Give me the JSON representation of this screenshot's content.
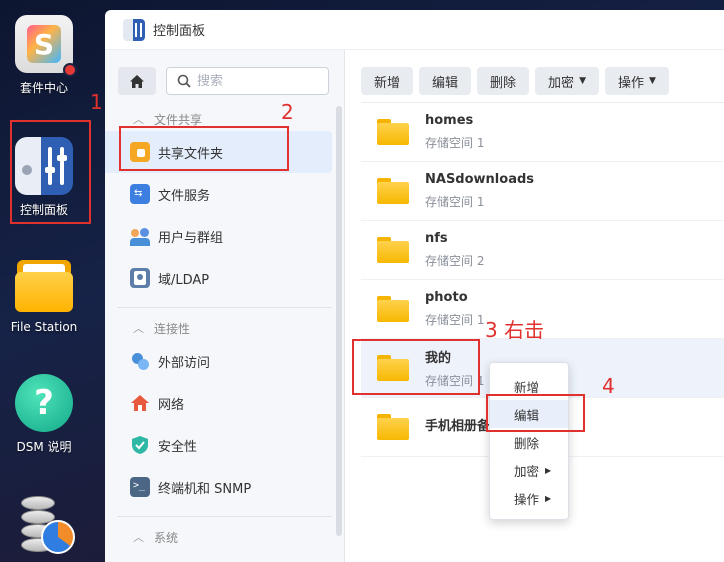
{
  "desktop": {
    "icons": [
      {
        "label": "套件中心"
      },
      {
        "label": "控制面板"
      },
      {
        "label": "File Station"
      },
      {
        "label": "DSM 说明"
      }
    ],
    "help_glyph": "?"
  },
  "window": {
    "title": "控制面板"
  },
  "sidebar": {
    "search_placeholder": "搜索",
    "sections": [
      {
        "title": "文件共享",
        "items": [
          {
            "label": "共享文件夹",
            "icon": "shared-folder-icon",
            "active": true
          },
          {
            "label": "文件服务",
            "icon": "file-services-icon"
          },
          {
            "label": "用户与群组",
            "icon": "users-groups-icon"
          },
          {
            "label": "域/LDAP",
            "icon": "domain-ldap-icon"
          }
        ]
      },
      {
        "title": "连接性",
        "items": [
          {
            "label": "外部访问",
            "icon": "external-access-icon"
          },
          {
            "label": "网络",
            "icon": "network-icon"
          },
          {
            "label": "安全性",
            "icon": "security-icon"
          },
          {
            "label": "终端机和 SNMP",
            "icon": "terminal-snmp-icon"
          }
        ]
      },
      {
        "title": "系统",
        "items": []
      }
    ]
  },
  "toolbar": {
    "create": "新增",
    "edit": "编辑",
    "delete": "删除",
    "encrypt": "加密",
    "action": "操作"
  },
  "folders": [
    {
      "name": "homes",
      "volume": "存储空间 1"
    },
    {
      "name": "NASdownloads",
      "volume": "存储空间 1"
    },
    {
      "name": "nfs",
      "volume": "存储空间 2"
    },
    {
      "name": "photo",
      "volume": "存储空间 1"
    },
    {
      "name": "我的",
      "volume": "存储空间 1"
    },
    {
      "name": "手机相册备",
      "volume": ""
    }
  ],
  "context_menu": {
    "create": "新增",
    "edit": "编辑",
    "delete": "删除",
    "encrypt": "加密",
    "action": "操作"
  },
  "annotations": {
    "step1": "1",
    "step2": "2",
    "step3": "3 右击",
    "step4": "4"
  },
  "colors": {
    "annotation_red": "#e0312f",
    "folder_yellow": "#ffc726",
    "selection_blue": "#e4edfb"
  }
}
